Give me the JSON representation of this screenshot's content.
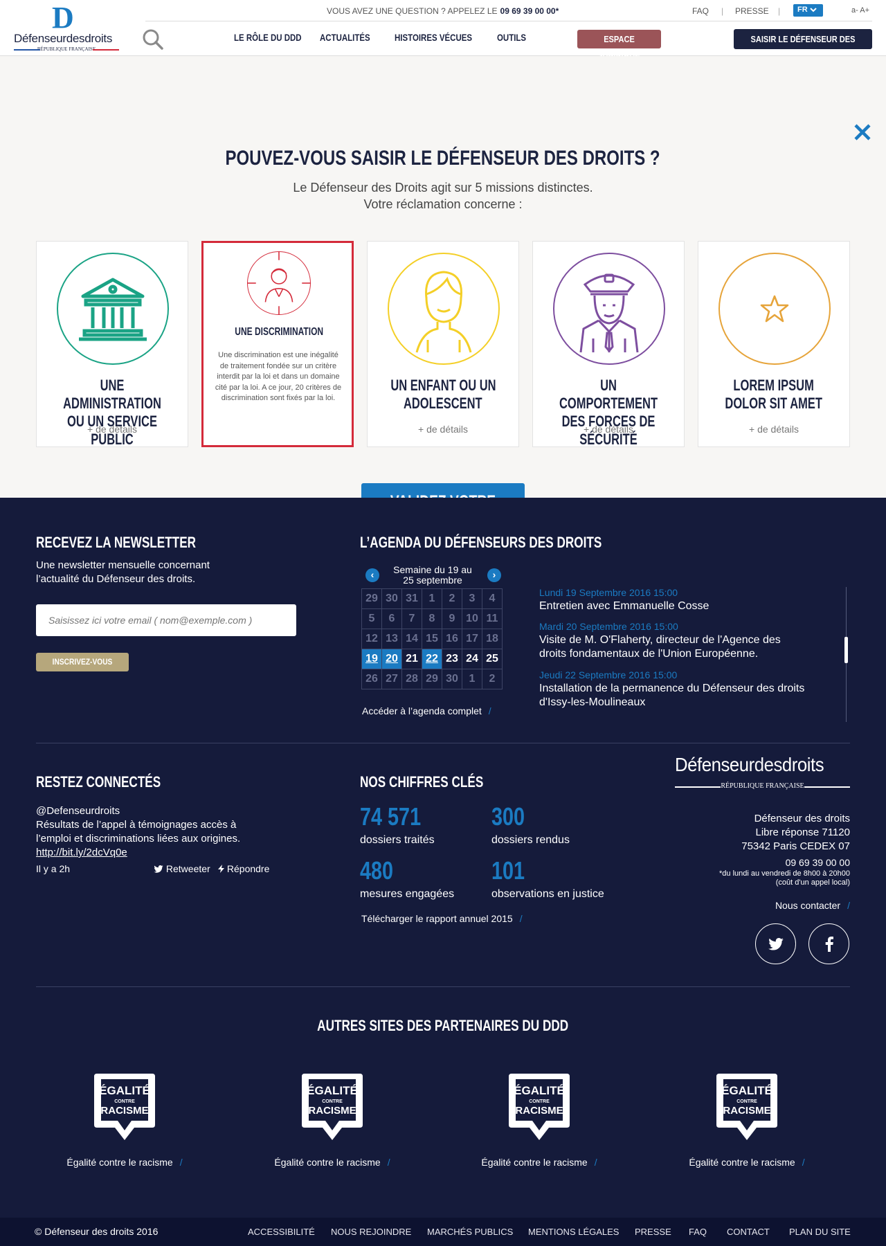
{
  "header": {
    "logo_main": "Défenseur",
    "logo_sub": "des",
    "logo_end": "droits",
    "logo_rep": "RÉPUBLIQUE FRANÇAISE",
    "question_label": "VOUS AVEZ UNE QUESTION ?  APPELEZ LE",
    "phone": "09 69 39 00 00*",
    "faq": "FAQ",
    "presse": "PRESSE",
    "lang": "FR",
    "font_size": "a- A+",
    "nav": [
      "LE RÔLE DU DDD",
      "ACTUALITÉS",
      "HISTOIRES VÉCUES",
      "OUTILS"
    ],
    "espace": "ESPACE JURIDIQUE",
    "saisir": "SAISIR LE DÉFENSEUR DES DROITS"
  },
  "modal": {
    "title": "POUVEZ-VOUS SAISIR LE DÉFENSEUR DES DROITS ?",
    "subtitle1": "Le Défenseur des Droits agit sur 5 missions distinctes.",
    "subtitle2": "Votre réclamation concerne :",
    "cards": [
      {
        "line1": "UNE ADMINISTRATION",
        "line2": "OU UN SERVICE PUBLIC",
        "details": "+ de détails",
        "color": "#1aa385",
        "icon": "building-icon"
      },
      {
        "line1": "UNE DISCRIMINATION",
        "line2": "",
        "description": "Une discrimination est une inégalité de traitement fondée sur un critère interdit par la loi et dans un domaine cité par la loi. A ce jour, 20 critères de discrimination sont fixés par la loi.",
        "color": "#d42a3a",
        "icon": "target-person-icon"
      },
      {
        "line1": "UN ENFANT OU UN",
        "line2": "ADOLESCENT",
        "details": "+ de détails",
        "color": "#f4cf27",
        "icon": "child-icon"
      },
      {
        "line1": "UN COMPORTEMENT",
        "line2": "DES FORCES DE SÉCURITÉ",
        "details": "+ de détails",
        "color": "#7d4e9f",
        "icon": "police-officer-icon"
      },
      {
        "line1": "LOREM IPSUM",
        "line2": "DOLOR SIT AMET",
        "details": "+ de détails",
        "color": "#e6a43a",
        "icon": "star-icon"
      }
    ],
    "validate": "VALIDEZ VOTRE CHOIX"
  },
  "newsletter": {
    "title": "RECEVEZ LA NEWSLETTER",
    "text1": "Une newsletter mensuelle concernant",
    "text2": "l’actualité du Défenseur des droits.",
    "placeholder": "Saisissez ici votre email ( nom@exemple.com )",
    "button": "INSCRIVEZ-VOUS"
  },
  "agenda": {
    "title": "L’AGENDA DU DÉFENSEURS DES DROITS",
    "week1": "Semaine du 19 au",
    "week2": "25 septembre",
    "calendar": [
      [
        "29",
        "30",
        "31",
        "1",
        "2",
        "3",
        "4"
      ],
      [
        "5",
        "6",
        "7",
        "8",
        "9",
        "10",
        "11"
      ],
      [
        "12",
        "13",
        "14",
        "15",
        "16",
        "17",
        "18"
      ],
      [
        "19",
        "20",
        "21",
        "22",
        "23",
        "24",
        "25"
      ],
      [
        "26",
        "27",
        "28",
        "29",
        "30",
        "1",
        "2"
      ]
    ],
    "link": "Accéder à l’agenda complet",
    "events": [
      {
        "date": "Lundi 19 Septembre 2016 15:00",
        "text": "Entretien avec Emmanuelle Cosse"
      },
      {
        "date": "Mardi 20 Septembre 2016 15:00",
        "text": "Visite de M. O'Flaherty, directeur de l'Agence des droits fondamentaux de l'Union Européenne."
      },
      {
        "date": "Jeudi 22 Septembre 2016 15:00",
        "text": "Installation de la permanence du Défenseur des droits d'Issy-les-Moulineaux"
      }
    ]
  },
  "connect": {
    "title": "RESTEZ CONNECTÉS",
    "handle": "@Defenseurdroits",
    "tweet1": "Résultats de l’appel à témoignages accès à",
    "tweet2": "l’emploi et discriminations liées aux origines.",
    "link": "http://bit.ly/2dcVq0e",
    "time": "Il y a 2h",
    "retweet": "Retweeter",
    "reply": "Répondre"
  },
  "chiffres": {
    "title": "NOS CHIFFRES CLÉS",
    "items": [
      {
        "value": "74 571",
        "label": "dossiers traités"
      },
      {
        "value": "300",
        "label": "dossiers rendus"
      },
      {
        "value": "480",
        "label": "mesures engagées"
      },
      {
        "value": "101",
        "label": "observations en justice"
      }
    ],
    "download": "Télécharger le rapport annuel 2015"
  },
  "contact": {
    "logo_main": "Défenseur",
    "logo_sub": "des",
    "logo_end": "droits",
    "logo_rep": "RÉPUBLIQUE FRANÇAISE",
    "addr1": "Défenseur des droits",
    "addr2": "Libre réponse 71120",
    "addr3": "75342 Paris CEDEX 07",
    "phone": "09 69 39 00 00",
    "hours1": "*du lundi au vendredi de 8h00 à 20h00",
    "hours2": "(coût d'un appel local)",
    "contact_link": "Nous contacter"
  },
  "partners": {
    "title": "AUTRES SITES DES PARTENAIRES DU DDD",
    "logo_text1": "ÉGALITÉ",
    "logo_text2": "CONTRE",
    "logo_text3": "RACISME",
    "items": [
      "Égalité contre le racisme",
      "Égalité contre le racisme",
      "Égalité contre le racisme",
      "Égalité contre le racisme"
    ]
  },
  "bottom": {
    "copyright": "© Défenseur des droits 2016",
    "links": [
      "ACCESSIBILITÉ",
      "NOUS REJOINDRE",
      "MARCHÉS PUBLICS",
      "MENTIONS LÉGALES",
      "PRESSE",
      "FAQ",
      "CONTACT",
      "PLAN DU SITE"
    ]
  }
}
